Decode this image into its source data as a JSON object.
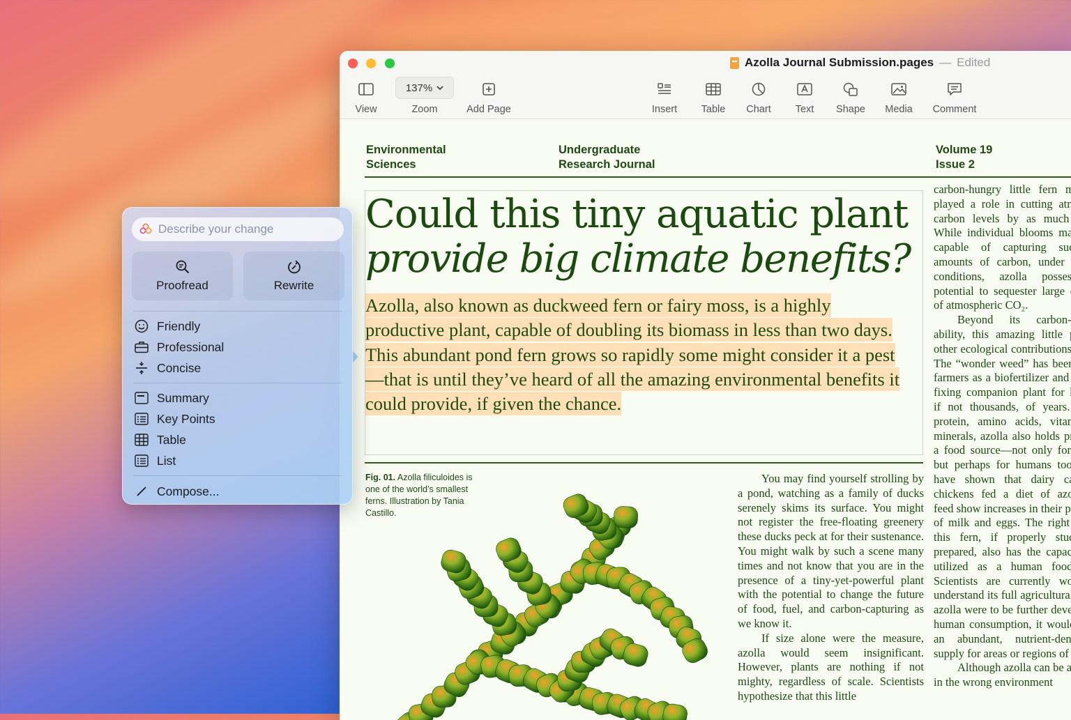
{
  "window": {
    "title": "Azolla Journal Submission.pages",
    "separator": "—",
    "status": "Edited"
  },
  "toolbar": {
    "view": "View",
    "zoom_value": "137%",
    "zoom": "Zoom",
    "add_page": "Add Page",
    "insert": "Insert",
    "table": "Table",
    "chart": "Chart",
    "text": "Text",
    "shape": "Shape",
    "media": "Media",
    "comment": "Comment"
  },
  "document": {
    "header_left_1": "Environmental",
    "header_left_2": "Sciences",
    "header_mid_1": "Undergraduate",
    "header_mid_2": "Research Journal",
    "header_right_1": "Volume 19",
    "header_right_2": "Issue 2",
    "headline_1": "Could this tiny aquatic plant",
    "headline_2": "provide big climate benefits?",
    "lede": "Azolla, also known as duckweed fern or fairy moss, is a highly productive plant, capable of doubling its biomass in less than two days. This abundant pond fern grows so rapidly some might consider it a pest—that is until they’ve heard of all the amazing environmental benefits it could provide, if given the chance.",
    "fig_label": "Fig. 01.",
    "fig_caption": "Azolla filiculoides is one of the world’s smallest ferns. Illustration by Tania Castillo.",
    "col_mid_p1": "You may find yourself strolling by a pond, watching as a family of ducks serenely skims its surface. You might not register the free-floating greenery these ducks peck at for their sustenance. You might walk by such a scene many times and not know that you are in the presence of a tiny-yet-powerful plant with the potential to change the future of food, fuel, and carbon-capturing as we know it.",
    "col_mid_p2": "If size alone were the measure, azolla would seem insignificant. However, plants are nothing if not mighty, regardless of scale. Scientists hypothesize that this little",
    "col_right_p1": "carbon-hungry little fern may have played a role in cutting atmospheric carbon levels by as much as half. While individual blooms may not be capable of capturing such large amounts of carbon, under the right conditions, azolla possesses the potential to sequester large quantities of atmospheric CO₂.",
    "col_right_p2": "Beyond its carbon-capturing ability, this amazing little plant has other ecological contributions to make. The “wonder weed” has been used by farmers as a biofertilizer and nitrogen-fixing companion plant for hundreds, if not thousands, of years. Rich in protein, amino acids, vitamins and minerals, azolla also holds promise as a food source—not only for animals, but perhaps for humans too. Studies have shown that dairy cattle and chickens fed a diet of azolla-based feed show increases in their production of milk and eggs. The right strain of this fern, if properly studied and prepared, also has the capacity to be utilized as a human food source. Scientists are currently working to understand its full agricultural value. If azolla were to be further developed for human consumption, it would provide an abundant, nutrient-dense food supply for areas or regions of scarcity.",
    "col_right_p3": "Although azolla can be a nuisance in the wrong environment"
  },
  "writing_tools": {
    "placeholder": "Describe your change",
    "proofread": "Proofread",
    "rewrite": "Rewrite",
    "friendly": "Friendly",
    "professional": "Professional",
    "concise": "Concise",
    "summary": "Summary",
    "key_points": "Key Points",
    "table": "Table",
    "list": "List",
    "compose": "Compose..."
  },
  "colors": {
    "accent_green": "#1b4a0f",
    "highlight": "#fde0b8",
    "close": "#fe5f57",
    "minimize": "#febc2e",
    "maximize": "#28c840"
  }
}
